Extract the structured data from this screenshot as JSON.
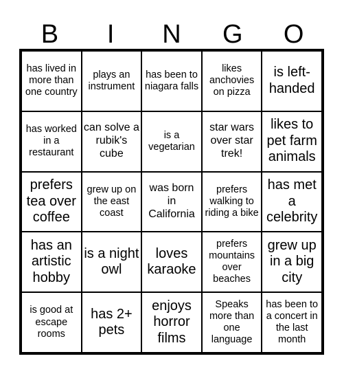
{
  "header": [
    "B",
    "I",
    "N",
    "G",
    "O"
  ],
  "cells": [
    [
      "has lived in more than one country",
      "plays an instrument",
      "has been to niagara falls",
      "likes anchovies on pizza",
      "is left-handed"
    ],
    [
      "has worked in a restaurant",
      "can solve a rubik's cube",
      "is a vegetarian",
      "star wars over star trek!",
      "likes to pet farm animals"
    ],
    [
      "prefers tea over coffee",
      "grew up on the east coast",
      "was born in California",
      "prefers walking to riding a bike",
      "has met a celebrity"
    ],
    [
      "has an artistic hobby",
      "is a night owl",
      "loves karaoke",
      "prefers mountains over beaches",
      "grew up in a big city"
    ],
    [
      "is good at escape rooms",
      "has 2+ pets",
      "enjoys horror films",
      "Speaks more than one language",
      "has been to a concert in the last month"
    ]
  ]
}
